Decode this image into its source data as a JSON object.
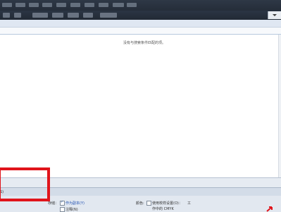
{
  "empty_message": "没有与搜索条件匹配的项。",
  "filename_row": {
    "label": "S)"
  },
  "options": {
    "left_label": "存储：",
    "as_copy": "作为副本(Y)",
    "annotations": "注释(N)",
    "color_label": "颜色:",
    "use_proof": "使用校样设置(O)：",
    "work_label": "工",
    "work_cmyk": "作中的 CMYK"
  },
  "colors": {
    "highlight_box": "#e0141b",
    "link_blue": "#1f4fb0"
  }
}
